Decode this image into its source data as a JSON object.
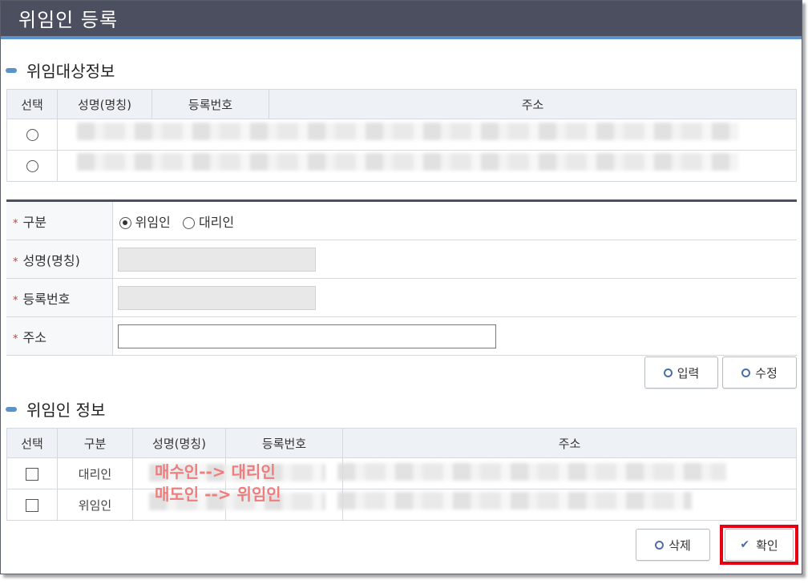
{
  "window": {
    "title": "위임인 등록"
  },
  "target_section": {
    "title": "위임대상정보",
    "columns": [
      "선택",
      "성명(명칭)",
      "등록번호",
      "주소"
    ],
    "rows": [
      {},
      {}
    ]
  },
  "form": {
    "type_label": "구분",
    "type_options": [
      "위임인",
      "대리인"
    ],
    "type_selected": "위임인",
    "name_label": "성명(명칭)",
    "reg_label": "등록번호",
    "address_label": "주소",
    "required_mark": "*"
  },
  "buttons": {
    "input": "입력",
    "edit": "수정",
    "delete": "삭제",
    "confirm": "확인"
  },
  "info_section": {
    "title": "위임인 정보",
    "columns": [
      "선택",
      "구분",
      "성명(명칭)",
      "등록번호",
      "주소"
    ],
    "rows": [
      {
        "type": "대리인"
      },
      {
        "type": "위임인"
      }
    ]
  },
  "annotations": {
    "line1": "매수인--> 대리인",
    "line2": "매도인 --> 위임인"
  },
  "colors": {
    "titlebar": "#4b4f60",
    "accent": "#5b93c8",
    "highlight": "#e60012",
    "note": "#f07c7c"
  }
}
